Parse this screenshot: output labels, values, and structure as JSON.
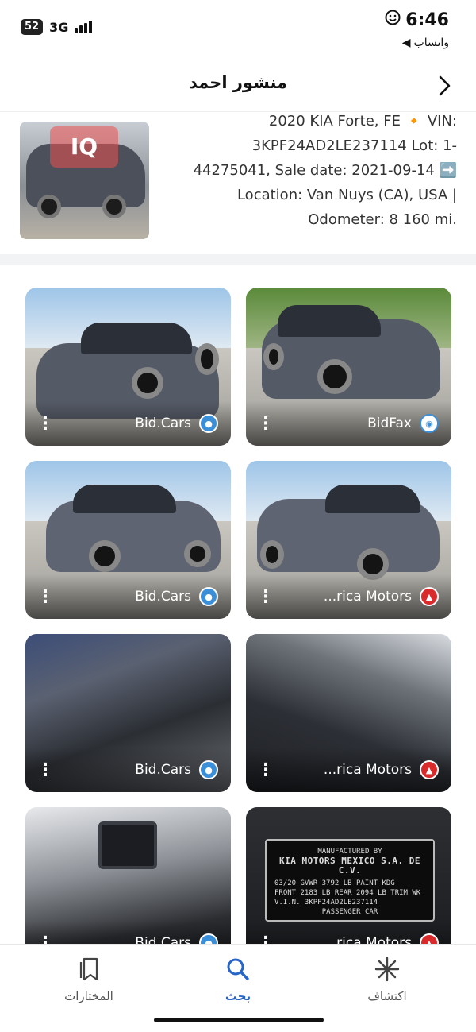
{
  "status_bar": {
    "battery": "52",
    "network": "3G",
    "time": "6:46",
    "back_app": "واتساب"
  },
  "header": {
    "title": "منشور احمد"
  },
  "summary": {
    "watermark": "IQ",
    "lines": [
      "2020 KIA Forte, FE 🔸 VIN:",
      "3KPF24AD2LE237114 Lot: 1-",
      "44275041, Sale date: 2021-09-14 ➡️",
      "Location: Van Nuys (CA), USA |",
      "Odometer: 8 160 mi."
    ]
  },
  "gallery": [
    {
      "source": "Bid.Cars",
      "source_icon": "bidcars-icon"
    },
    {
      "source": "BidFax",
      "source_icon": "bidfax-icon"
    },
    {
      "source": "Bid.Cars",
      "source_icon": "bidcars-icon"
    },
    {
      "source": "...rica Motors",
      "source_icon": "america-motors-icon"
    },
    {
      "source": "Bid.Cars",
      "source_icon": "bidcars-icon"
    },
    {
      "source": "...rica Motors",
      "source_icon": "america-motors-icon"
    },
    {
      "source": "Bid.Cars",
      "source_icon": "bidcars-icon"
    },
    {
      "source": "...rica Motors",
      "source_icon": "america-motors-icon"
    }
  ],
  "sticker": {
    "maker": "KIA MOTORS MEXICO S.A. DE C.V.",
    "lines": [
      "MANUFACTURED BY",
      "03/20   GVWR 3792 LB   PAINT KDG",
      "FRONT 2183 LB  REAR 2094 LB  TRIM WK",
      "V.I.N. 3KPF24AD2LE237114",
      "PASSENGER CAR"
    ]
  },
  "bottom_nav": {
    "items": [
      {
        "label": "المختارات",
        "icon": "bookmark-icon",
        "active": false
      },
      {
        "label": "بحث",
        "icon": "search-icon",
        "active": true
      },
      {
        "label": "اكتشاف",
        "icon": "sparkle-icon",
        "active": false
      }
    ]
  },
  "colors": {
    "accent": "#2766c9",
    "bidcars": "#3b8fd9",
    "america_motors": "#d92b2b"
  }
}
